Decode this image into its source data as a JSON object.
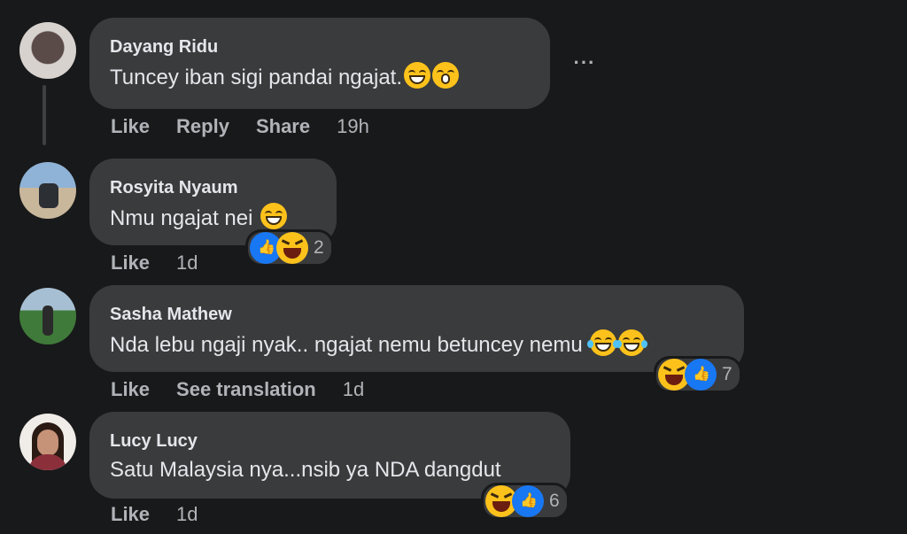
{
  "comments": [
    {
      "author": "Dayang Ridu",
      "text": "Tuncey iban sigi pandai ngajat.",
      "emojis": [
        "grinning-face",
        "face-with-hand-over-mouth"
      ],
      "actions": {
        "like": "Like",
        "reply": "Reply",
        "share": "Share"
      },
      "time": "19h",
      "more": "···"
    },
    {
      "author": "Rosyita Nyaum",
      "text": "Nmu ngajat nei",
      "emojis": [
        "squinting-laughing-face"
      ],
      "actions": {
        "like": "Like"
      },
      "time": "1d",
      "reactions": [
        "like",
        "haha"
      ],
      "reaction_count": "2"
    },
    {
      "author": "Sasha Mathew",
      "text": "Nda lebu ngaji nyak.. ngajat nemu betuncey nemu",
      "emojis": [
        "face-with-tears-of-joy",
        "face-with-tears-of-joy"
      ],
      "actions": {
        "like": "Like",
        "translate": "See translation"
      },
      "time": "1d",
      "reactions": [
        "haha",
        "like"
      ],
      "reaction_count": "7"
    },
    {
      "author": "Lucy Lucy",
      "text": "Satu Malaysia nya...nsib ya NDA dangdut",
      "actions": {
        "like": "Like"
      },
      "time": "1d",
      "reactions": [
        "haha",
        "like"
      ],
      "reaction_count": "6"
    }
  ],
  "colors": {
    "background": "#18191a",
    "bubble": "#3a3b3c",
    "like_blue": "#1877f2",
    "muted": "#b0b3b8"
  }
}
